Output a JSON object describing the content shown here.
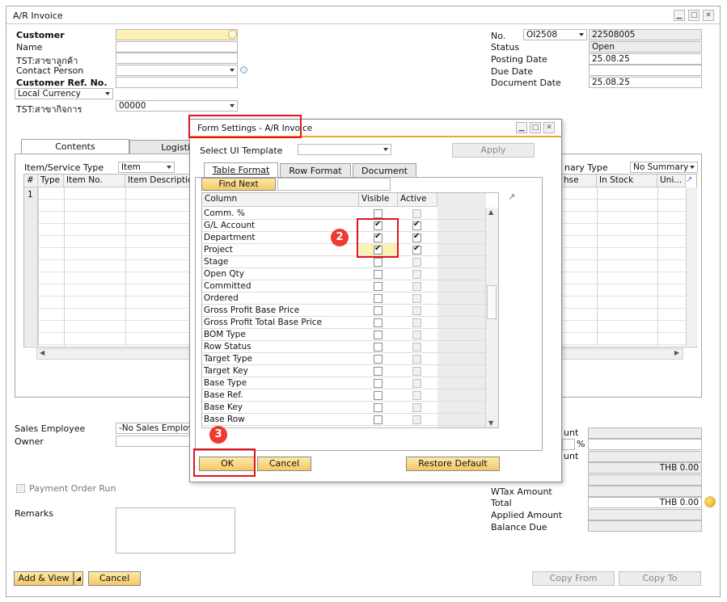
{
  "window": {
    "title": "A/R Invoice"
  },
  "header_left": {
    "customer_label": "Customer",
    "name_label": "Name",
    "tst_customer_label": "TST:สาขาลูกค้า",
    "contact_label": "Contact Person",
    "custref_label": "Customer Ref. No.",
    "currency_value": "Local Currency",
    "tst_branch_label": "TST:สาขากิจการ",
    "branch_value": "00000"
  },
  "header_right": {
    "no_label": "No.",
    "series_value": "OI2508",
    "number_value": "22508005",
    "status_label": "Status",
    "status_value": "Open",
    "posting_label": "Posting Date",
    "posting_value": "25.08.25",
    "due_label": "Due Date",
    "document_label": "Document Date",
    "document_value": "25.08.25"
  },
  "tabs": {
    "contents": "Contents",
    "logistics": "Logisti"
  },
  "grid": {
    "type_label": "Item/Service Type",
    "type_value": "Item",
    "summary_label": "nary Type",
    "summary_value": "No Summary",
    "columns": [
      "#",
      "Type",
      "Item No.",
      "Item Description"
    ],
    "right_columns": [
      "hse",
      "In Stock",
      "Uni..."
    ],
    "first_row": "1"
  },
  "footer_left": {
    "sales_employee_label": "Sales Employee",
    "sales_employee_value": "-No Sales Employee-",
    "owner_label": "Owner",
    "payment_order_label": "Payment Order Run",
    "remarks_label": "Remarks"
  },
  "footer_right": {
    "discount_label": "unt",
    "percent_sign": "%",
    "freight_label": "unt",
    "tax_value": "THB 0.00",
    "wtax_label": "WTax Amount",
    "total_label": "Total",
    "total_value": "THB 0.00",
    "applied_label": "Applied Amount",
    "balance_label": "Balance Due"
  },
  "buttons": {
    "add_view": "Add & View",
    "cancel": "Cancel",
    "copy_from": "Copy From",
    "copy_to": "Copy To"
  },
  "dialog": {
    "title": "Form Settings - A/R Invoice",
    "ui_template_label": "Select UI Template",
    "apply": "Apply",
    "tabs": [
      "Table Format",
      "Row Format",
      "Document"
    ],
    "find_next": "Find Next",
    "col_column": "Column",
    "col_visible": "Visible",
    "col_active": "Active",
    "rows": [
      {
        "name": "Comm. %",
        "visible": false,
        "active": false,
        "active_enabled": false
      },
      {
        "name": "G/L Account",
        "visible": true,
        "active": true,
        "active_enabled": true
      },
      {
        "name": "Department",
        "visible": true,
        "active": true,
        "active_enabled": true
      },
      {
        "name": "Project",
        "visible": true,
        "active": true,
        "active_enabled": true
      },
      {
        "name": "Stage",
        "visible": false,
        "active": false,
        "active_enabled": false
      },
      {
        "name": "Open Qty",
        "visible": false,
        "active": false,
        "active_enabled": false
      },
      {
        "name": "Committed",
        "visible": false,
        "active": false,
        "active_enabled": false
      },
      {
        "name": "Ordered",
        "visible": false,
        "active": false,
        "active_enabled": false
      },
      {
        "name": "Gross Profit Base Price",
        "visible": false,
        "active": false,
        "active_enabled": false
      },
      {
        "name": "Gross Profit Total Base Price",
        "visible": false,
        "active": false,
        "active_enabled": false
      },
      {
        "name": "BOM Type",
        "visible": false,
        "active": false,
        "active_enabled": false
      },
      {
        "name": "Row Status",
        "visible": false,
        "active": false,
        "active_enabled": false
      },
      {
        "name": "Target Type",
        "visible": false,
        "active": false,
        "active_enabled": false
      },
      {
        "name": "Target Key",
        "visible": false,
        "active": false,
        "active_enabled": false
      },
      {
        "name": "Base Type",
        "visible": false,
        "active": false,
        "active_enabled": false
      },
      {
        "name": "Base Ref.",
        "visible": false,
        "active": false,
        "active_enabled": false
      },
      {
        "name": "Base Key",
        "visible": false,
        "active": false,
        "active_enabled": false
      },
      {
        "name": "Base Row",
        "visible": false,
        "active": false,
        "active_enabled": false
      }
    ],
    "ok": "OK",
    "cancel": "Cancel",
    "restore": "Restore Default"
  },
  "markers": {
    "step2": "2",
    "step3": "3"
  },
  "colors": {
    "highlight": "#e0141e",
    "marker": "#ee3a31",
    "button": "#f5c868",
    "dialog_accent": "#f2a52b"
  }
}
